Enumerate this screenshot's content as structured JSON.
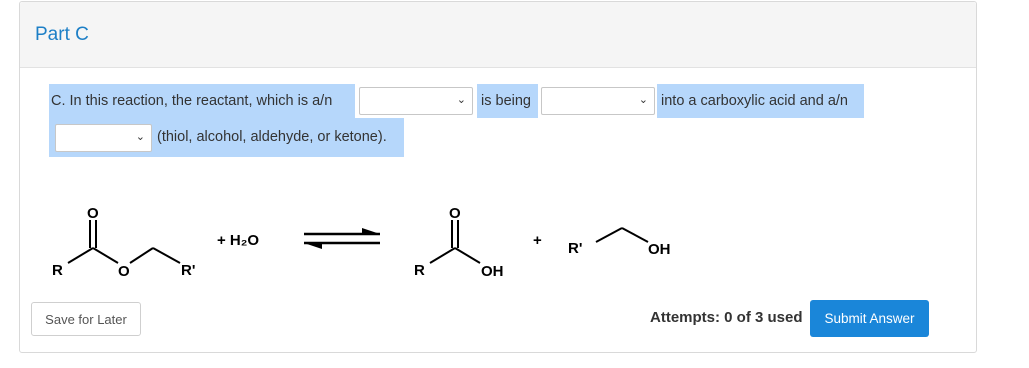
{
  "header": {
    "title": "Part C"
  },
  "question": {
    "prefix": "C. In this reaction, the reactant, which is a/n",
    "mid1": "is being",
    "mid2": "into a carboxylic acid and a/n",
    "suffix": "(thiol, alcohol, aldehyde, or ketone).",
    "select1": {
      "value": ""
    },
    "select2": {
      "value": ""
    },
    "select3": {
      "value": ""
    }
  },
  "reaction": {
    "left_R": "R",
    "left_O_ester": "O",
    "left_R_prime": "R'",
    "left_carbonyl_O": "O",
    "plus_water": "+ H₂O",
    "right_carbonyl_O": "O",
    "right_R": "R",
    "right_OH": "OH",
    "plus": "+",
    "alc_R_prime": "R'",
    "alc_OH": "OH"
  },
  "footer": {
    "save_label": "Save for Later",
    "attempts_text": "Attempts: 0 of 3 used",
    "submit_label": "Submit Answer"
  },
  "colors": {
    "accent": "#1a86d9",
    "highlight": "#b6d7fb",
    "title": "#1d7fc6"
  }
}
